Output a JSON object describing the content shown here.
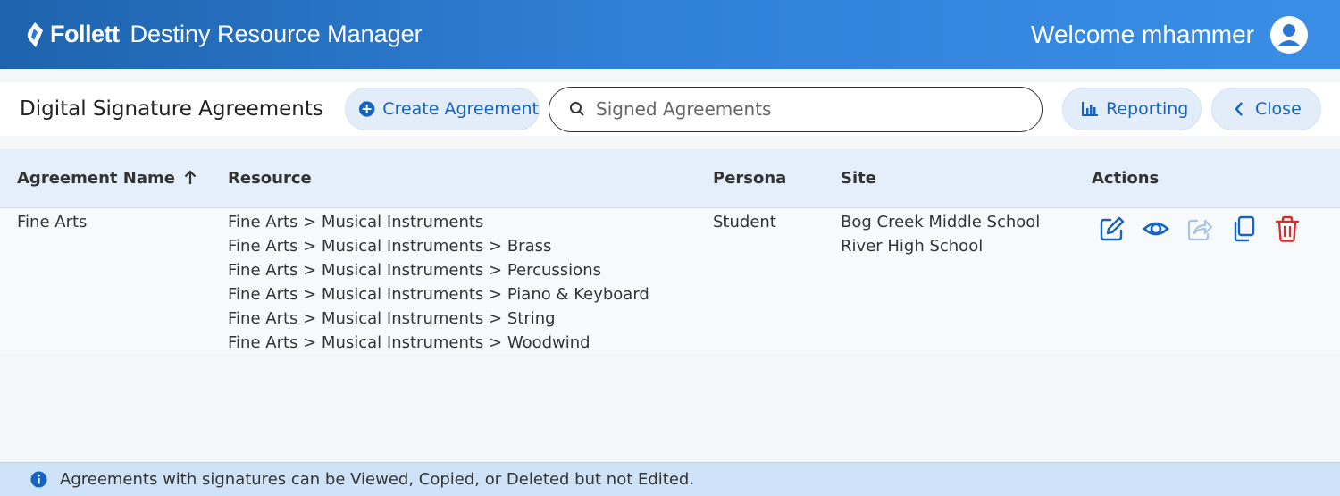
{
  "header": {
    "brand": "Follett",
    "product": "Destiny Resource Manager",
    "welcome": "Welcome mhammer",
    "brand_color": "#2a78d0"
  },
  "toolbar": {
    "title": "Digital Signature Agreements",
    "create_label": "Create Agreement",
    "search_placeholder": "Signed Agreements",
    "reporting_label": "Reporting",
    "close_label": "Close"
  },
  "table": {
    "columns": [
      "Agreement Name",
      "Resource",
      "Persona",
      "Site",
      "Actions"
    ],
    "rows": [
      {
        "name": "Fine Arts",
        "resources": [
          "Fine Arts > Musical Instruments",
          "Fine Arts > Musical Instruments > Brass",
          "Fine Arts > Musical Instruments > Percussions",
          "Fine Arts > Musical Instruments > Piano & Keyboard",
          "Fine Arts > Musical Instruments > String",
          "Fine Arts > Musical Instruments > Woodwind"
        ],
        "persona": "Student",
        "sites": [
          "Bog Creek Middle School",
          "River High School"
        ],
        "actions": [
          "edit-icon",
          "view-icon",
          "share-icon",
          "copy-icon",
          "delete-icon"
        ]
      }
    ]
  },
  "footer": {
    "info": "Agreements with signatures can be Viewed, Copied, or Deleted but not Edited."
  },
  "colors": {
    "accent": "#1565c0",
    "delete": "#d32f2f",
    "disabled": "#a9c4e0"
  }
}
